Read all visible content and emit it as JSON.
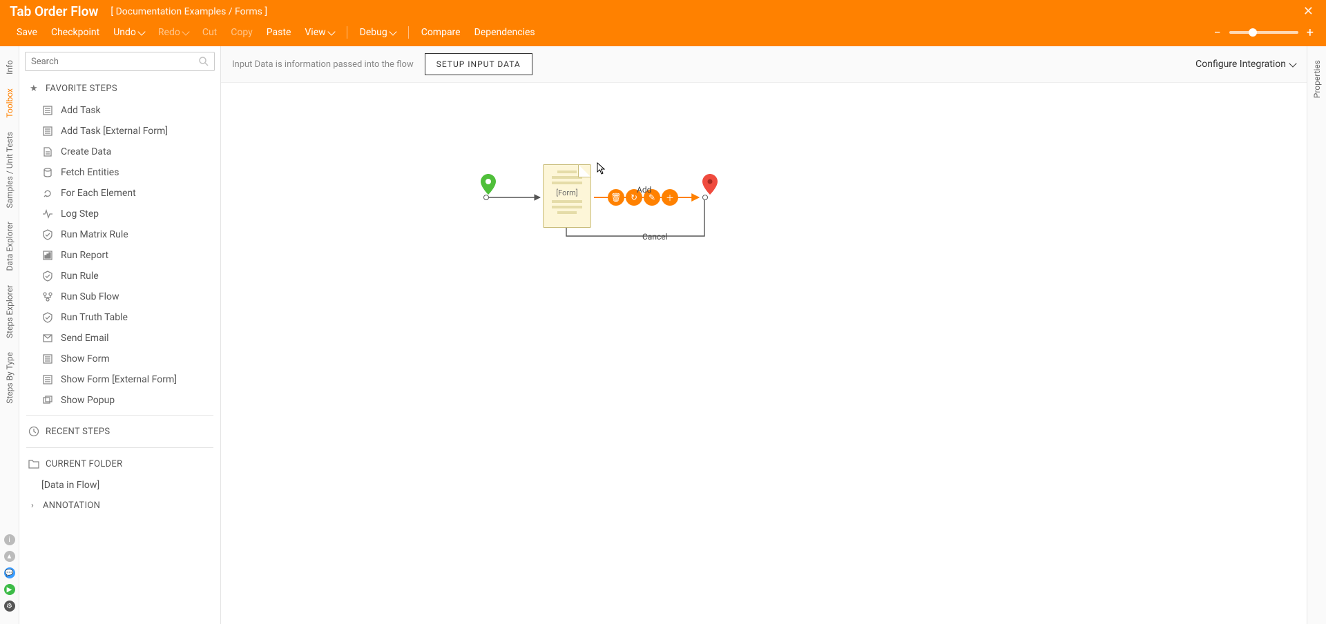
{
  "header": {
    "title": "Tab Order Flow",
    "breadcrumb": "[ Documentation Examples / Forms ]",
    "menu": {
      "save": "Save",
      "checkpoint": "Checkpoint",
      "undo": "Undo",
      "redo": "Redo",
      "cut": "Cut",
      "copy": "Copy",
      "paste": "Paste",
      "view": "View",
      "debug": "Debug",
      "compare": "Compare",
      "dependencies": "Dependencies"
    }
  },
  "left_rail": {
    "tabs": [
      "Info",
      "Toolbox",
      "Samples / Unit Tests",
      "Data Explorer",
      "Steps Explorer",
      "Steps By Type"
    ],
    "active": "Toolbox"
  },
  "right_rail": {
    "tab": "Properties"
  },
  "sidebar": {
    "search_placeholder": "Search",
    "sections": {
      "favorite": "FAVORITE STEPS",
      "recent": "RECENT STEPS",
      "current_folder": "CURRENT FOLDER",
      "annotation": "ANNOTATION"
    },
    "favorite_steps": [
      "Add Task",
      "Add Task [External Form]",
      "Create Data",
      "Fetch Entities",
      "For Each Element",
      "Log Step",
      "Run Matrix Rule",
      "Run Report",
      "Run Rule",
      "Run Sub Flow",
      "Run Truth Table",
      "Send Email",
      "Show Form",
      "Show Form [External Form]",
      "Show Popup"
    ],
    "current_folder_items": [
      "[Data in Flow]"
    ]
  },
  "infobar": {
    "text": "Input Data is information passed into the flow",
    "button": "SETUP INPUT DATA",
    "config": "Configure Integration"
  },
  "canvas": {
    "form_label": "[Form]",
    "path_add": "Add",
    "path_cancel": "Cancel"
  }
}
